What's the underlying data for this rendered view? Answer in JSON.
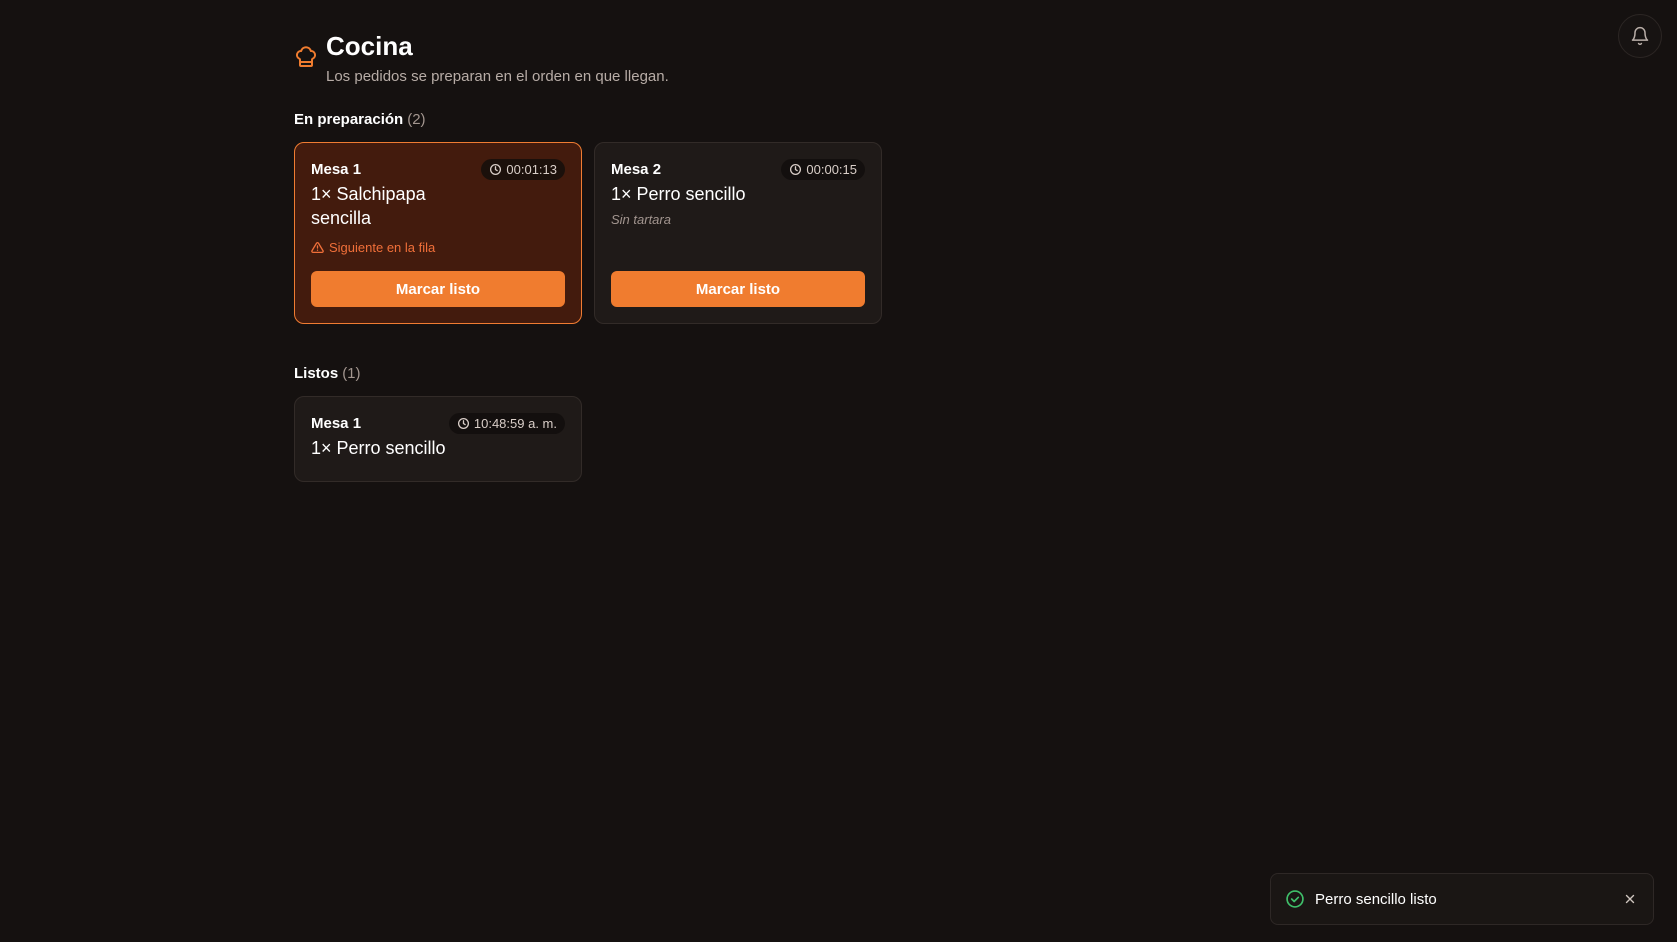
{
  "header": {
    "title": "Cocina",
    "subtitle": "Los pedidos se preparan en el orden en que llegan."
  },
  "sections": {
    "in_progress": {
      "label": "En preparación",
      "count": "(2)"
    },
    "ready": {
      "label": "Listos",
      "count": "(1)"
    }
  },
  "orders_in_progress": [
    {
      "table": "Mesa 1",
      "timer": "00:01:13",
      "item": "1× Salchipapa sencilla",
      "warning": "Siguiente en la fila",
      "button": "Marcar listo"
    },
    {
      "table": "Mesa 2",
      "timer": "00:00:15",
      "item": "1× Perro sencillo",
      "note": "Sin tartara",
      "button": "Marcar listo"
    }
  ],
  "orders_ready": [
    {
      "table": "Mesa 1",
      "time": "10:48:59 a. m.",
      "item": "1× Perro sencillo"
    }
  ],
  "toast": {
    "message": "Perro sencillo listo"
  },
  "colors": {
    "accent": "#f07c2f",
    "background": "#151110",
    "success": "#3fbf6a"
  },
  "icons": {
    "header": "chef-hat-icon",
    "notifications": "bell-icon",
    "timer": "clock-icon",
    "warning": "warning-triangle-icon",
    "toast_status": "check-circle-icon",
    "toast_close": "close-icon"
  }
}
